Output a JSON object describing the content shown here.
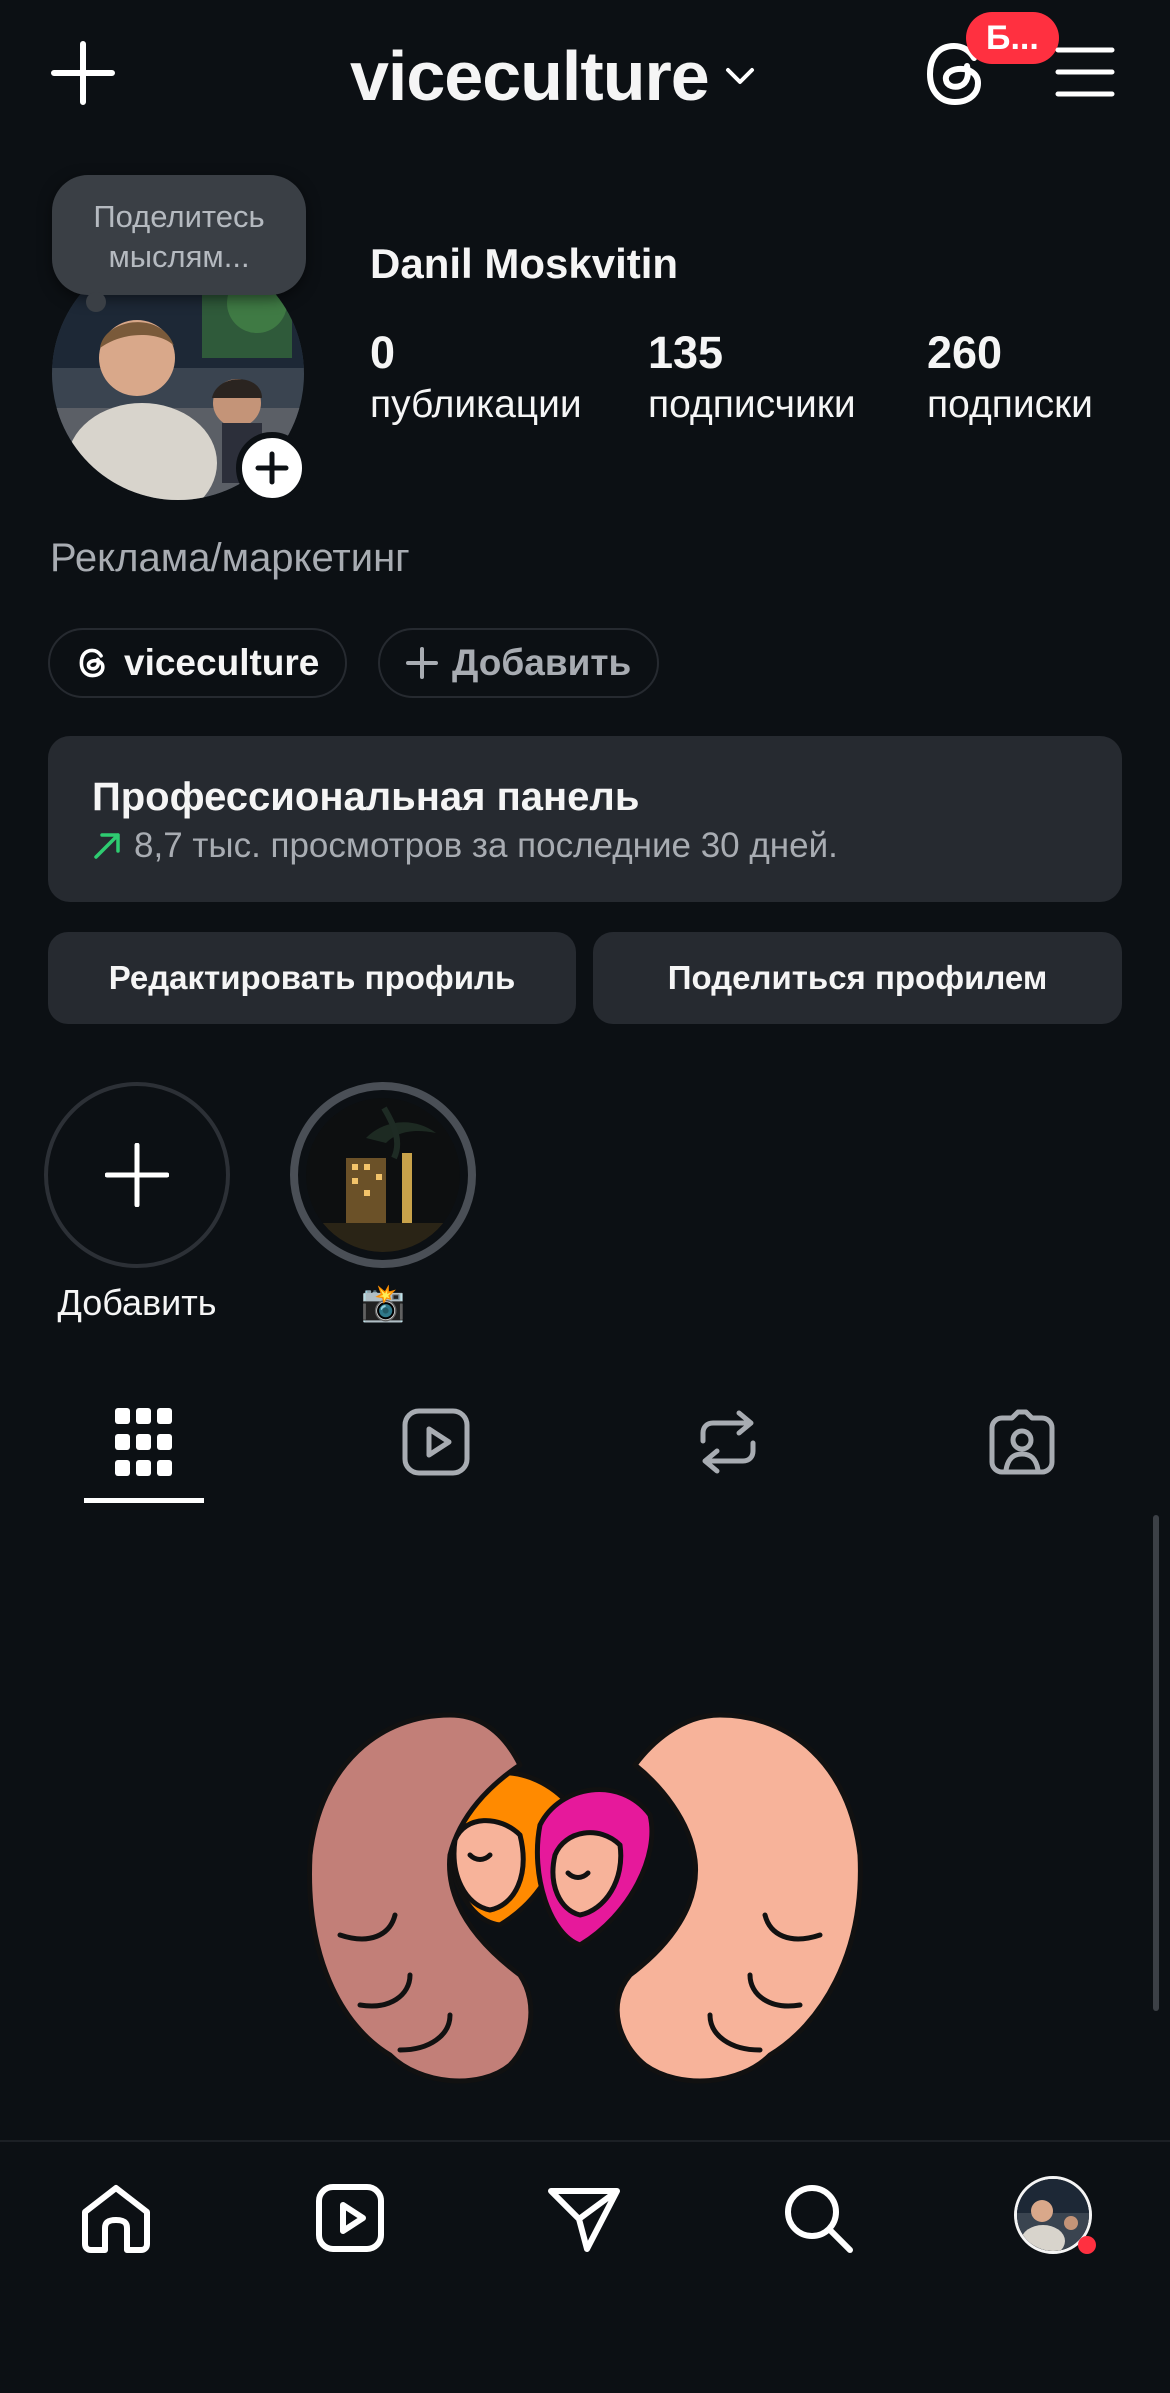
{
  "header": {
    "username": "viceculture",
    "notification_badge": "Б...",
    "icons": [
      "plus-icon",
      "chevron-down-icon",
      "threads-icon",
      "menu-icon"
    ]
  },
  "profile": {
    "note_placeholder": "Поделитесь мыслям...",
    "display_name": "Danil Moskvitin",
    "stats": [
      {
        "value": "0",
        "label": "публикации"
      },
      {
        "value": "135",
        "label": "подписчики"
      },
      {
        "value": "260",
        "label": "подписки"
      }
    ],
    "category": "Реклама/маркетинг",
    "threads_chip": "viceculture",
    "add_chip": "Добавить"
  },
  "pro_panel": {
    "title": "Профессиональная панель",
    "subtitle": "8,7 тыс. просмотров за последние 30 дней."
  },
  "actions": {
    "edit_profile": "Редактировать профиль",
    "share_profile": "Поделиться профилем"
  },
  "highlights": [
    {
      "label": "Добавить",
      "type": "add"
    },
    {
      "label": "📸",
      "type": "story"
    }
  ],
  "tabs": [
    "grid-icon",
    "reels-icon",
    "reposts-icon",
    "tagged-icon"
  ],
  "active_tab": 0,
  "bottom_nav": [
    "home-icon",
    "reels-icon",
    "direct-icon",
    "search-icon",
    "profile-avatar"
  ],
  "colors": {
    "background": "#0c1014",
    "surface": "#262a30",
    "accent_red": "#ff3040",
    "trend_green": "#2ecc71"
  }
}
